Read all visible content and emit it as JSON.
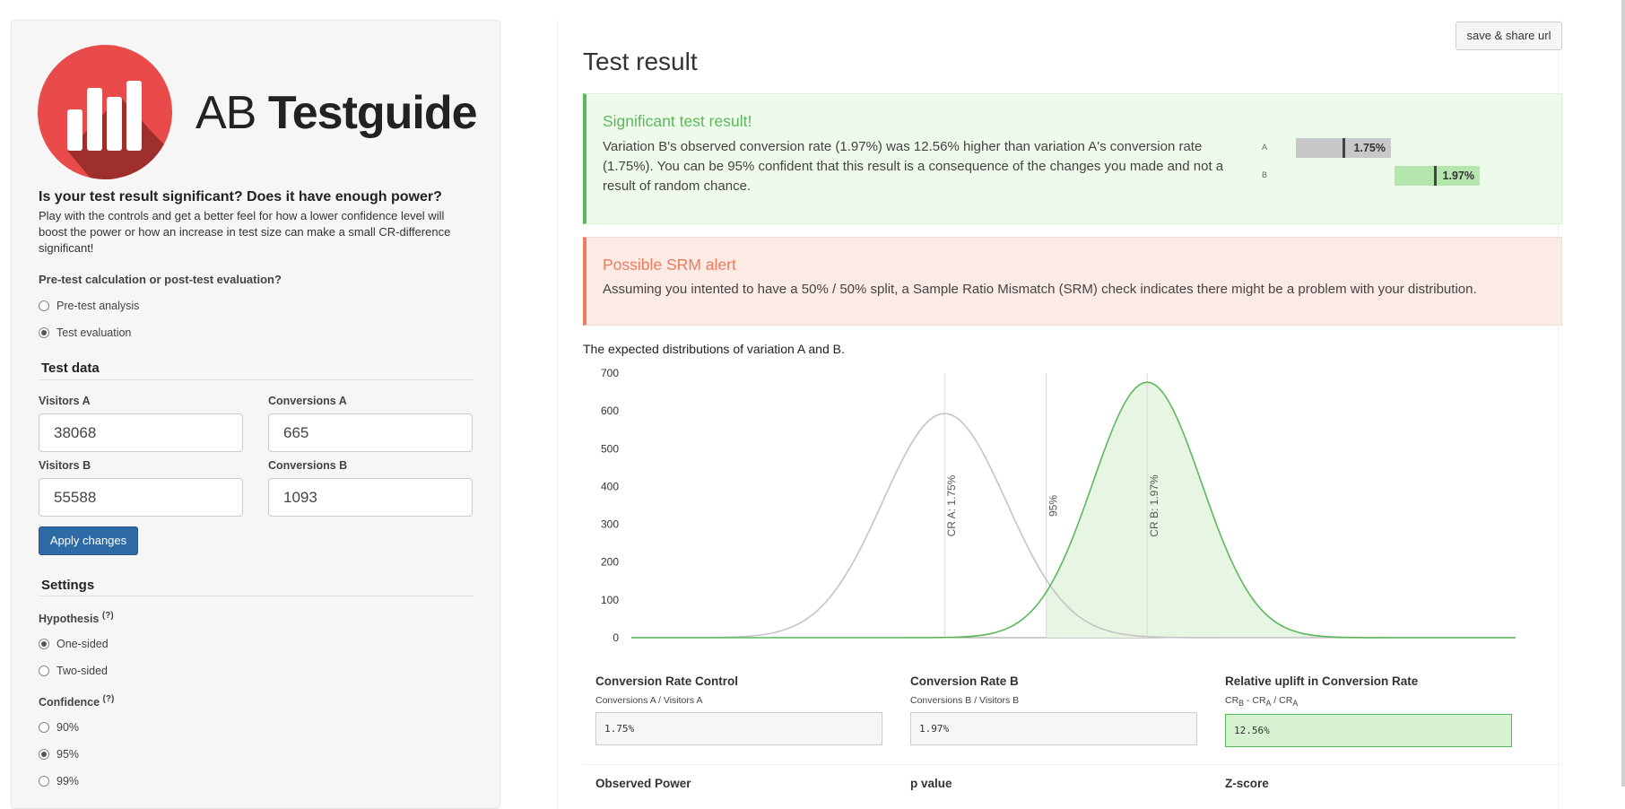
{
  "brand": {
    "light": "AB",
    "bold": "Testguide"
  },
  "intro": {
    "title": "Is your test result significant? Does it have enough power?",
    "text": "Play with the controls and get a better feel for how a lower confidence level will boost the power or how an increase in test size can make a small CR-difference significant!"
  },
  "mode": {
    "label": "Pre-test calculation or post-test evaluation?",
    "options": [
      "Pre-test analysis",
      "Test evaluation"
    ],
    "selected": "Test evaluation"
  },
  "test_data": {
    "title": "Test data",
    "visitors_a_label": "Visitors A",
    "visitors_a": "38068",
    "conversions_a_label": "Conversions A",
    "conversions_a": "665",
    "visitors_b_label": "Visitors B",
    "visitors_b": "55588",
    "conversions_b_label": "Conversions B",
    "conversions_b": "1093",
    "apply_label": "Apply changes"
  },
  "settings": {
    "title": "Settings",
    "hypothesis_label": "Hypothesis",
    "help_mark": "(?)",
    "hypothesis_options": [
      "One-sided",
      "Two-sided"
    ],
    "hypothesis_selected": "One-sided",
    "confidence_label": "Confidence",
    "confidence_options": [
      "90%",
      "95%",
      "99%"
    ],
    "confidence_selected": "95%"
  },
  "header": {
    "share_label": "save & share url",
    "title": "Test result"
  },
  "significant": {
    "title": "Significant test result!",
    "text": "Variation B's observed conversion rate (1.97%) was 12.56% higher than variation A's conversion rate (1.75%). You can be 95% confident that this result is a consequence of the changes you made and not a result of random chance.",
    "bar_a_label": "A",
    "bar_a_value": "1.75%",
    "bar_b_label": "B",
    "bar_b_value": "1.97%",
    "color_a": "#c8c8c8",
    "color_b": "#b5e6ad"
  },
  "srm": {
    "title": "Possible SRM alert",
    "text": "Assuming you intented to have a 50% / 50% split, a Sample Ratio Mismatch (SRM) check indicates there might be a problem with your distribution."
  },
  "chart_caption": "The expected distributions of variation A and B.",
  "chart_data": {
    "type": "area",
    "ylim": [
      0,
      700
    ],
    "yticks": [
      0,
      100,
      200,
      300,
      400,
      500,
      600,
      700
    ],
    "xlim": [
      1.41,
      2.37
    ],
    "series": [
      {
        "mean": 1.75,
        "sd": 0.0672,
        "peak": 593,
        "color": "#c4c4c4"
      },
      {
        "mean": 1.97,
        "sd": 0.059,
        "peak": 676,
        "color": "#5cb85c",
        "fill_from": 1.8605
      }
    ],
    "annotations": [
      {
        "x": 1.75,
        "label": "CR A: 1.75%"
      },
      {
        "x": 1.8605,
        "label": "95%"
      },
      {
        "x": 1.97,
        "label": "CR B: 1.97%"
      }
    ]
  },
  "metrics": [
    {
      "title": "Conversion Rate Control",
      "sub": "Conversions A / Visitors A",
      "value": "1.75%"
    },
    {
      "title": "Conversion Rate B",
      "sub": "Conversions B / Visitors B",
      "value": "1.97%"
    },
    {
      "title": "Relative uplift in Conversion Rate",
      "value": "12.56%"
    }
  ],
  "uplift_formula": {
    "cr": "CR",
    "sub_b": "B",
    "sep": " - ",
    "sub_a": "A",
    "div": " / "
  },
  "metrics_row2": [
    "Observed Power",
    "p value",
    "Z-score"
  ]
}
